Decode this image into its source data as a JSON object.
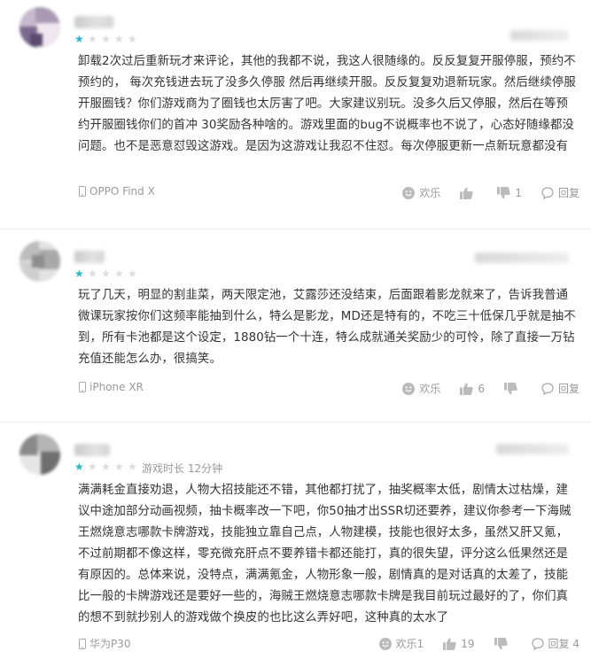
{
  "reviews": [
    {
      "rating": 1,
      "playtime": "",
      "text": "卸载2次过后重新玩才来评论，其他的我都不说，我这人很随缘的。反反复复开服停服，预约不预约的，  每次充钱进去玩了没多久停服 然后再继续开服。反反复复劝退新玩家。然后继续停服开服圈钱？你们游戏商为了圈钱也太厉害了吧。大家建议别玩。没多久后又停服，然后在等预约开服圈钱你们的首冲 30奖励各种啥的。游戏里面的bug不说概率也不说了，心态好随缘都没问题。也不是恶意怼毁这游戏。是因为这游戏让我忍不住怼。每次停服更新一点新玩意都没有",
      "device": "OPPO Find X",
      "device_icon": "phone-icon",
      "happy_label": "欢乐",
      "likes": "",
      "dislikes": "1",
      "reply_label": "回复"
    },
    {
      "rating": 1,
      "playtime": "",
      "text": "玩了几天，明显的割韭菜，两天限定池，艾露莎还没结束，后面跟着影龙就来了，告诉我普通微课玩家按你们这频率能抽到什么，特么是影龙，MD还是特有的，不吃三十低保几乎就是抽不到，所有卡池都是这个设定，1880钻一个十连，特么成就通关奖励少的可怜，除了直接一万钻充值还能怎么办，很搞笑。",
      "device": "iPhone XR",
      "device_icon": "phone-icon",
      "happy_label": "欢乐",
      "likes": "6",
      "dislikes": "",
      "reply_label": "回复"
    },
    {
      "rating": 1,
      "playtime": "游戏时长 12分钟",
      "text": "满满耗金直接劝退，人物大招技能还不错，其他都打扰了，抽奖概率太低，剧情太过枯燥，建议中途加部分动画视频，抽卡概率改一下吧，你50抽才出SSR切还要养，建议你参考一下海贼王燃烧意志哪款卡牌游戏，技能独立靠自己点，人物建模，技能也很好太多，虽然又肝又氪，不过前期都不像这样，零充微充肝点不要养错卡都还能打，真的很失望，评分这么低果然还是有原因的。总体来说，没特点，满满氪金，人物形象一般，剧情真的是对话真的太差了，技能比一般的卡牌游戏还是要好一些的，海贼王燃烧意志哪款卡牌是我目前玩过最好的了，你们真的想不到就抄别人的游戏做个换皮的也比这么弄好吧，这种真的太水了",
      "device": "华为P30",
      "device_icon": "phone-icon",
      "happy_label": "欢乐1",
      "likes": "19",
      "dislikes": "",
      "reply_label": "回复 4"
    }
  ],
  "colors": {
    "star_on": "#2bb5c9",
    "star_off": "#dcdcdc",
    "text": "#333333",
    "muted": "#999999",
    "divider": "#ececec"
  }
}
